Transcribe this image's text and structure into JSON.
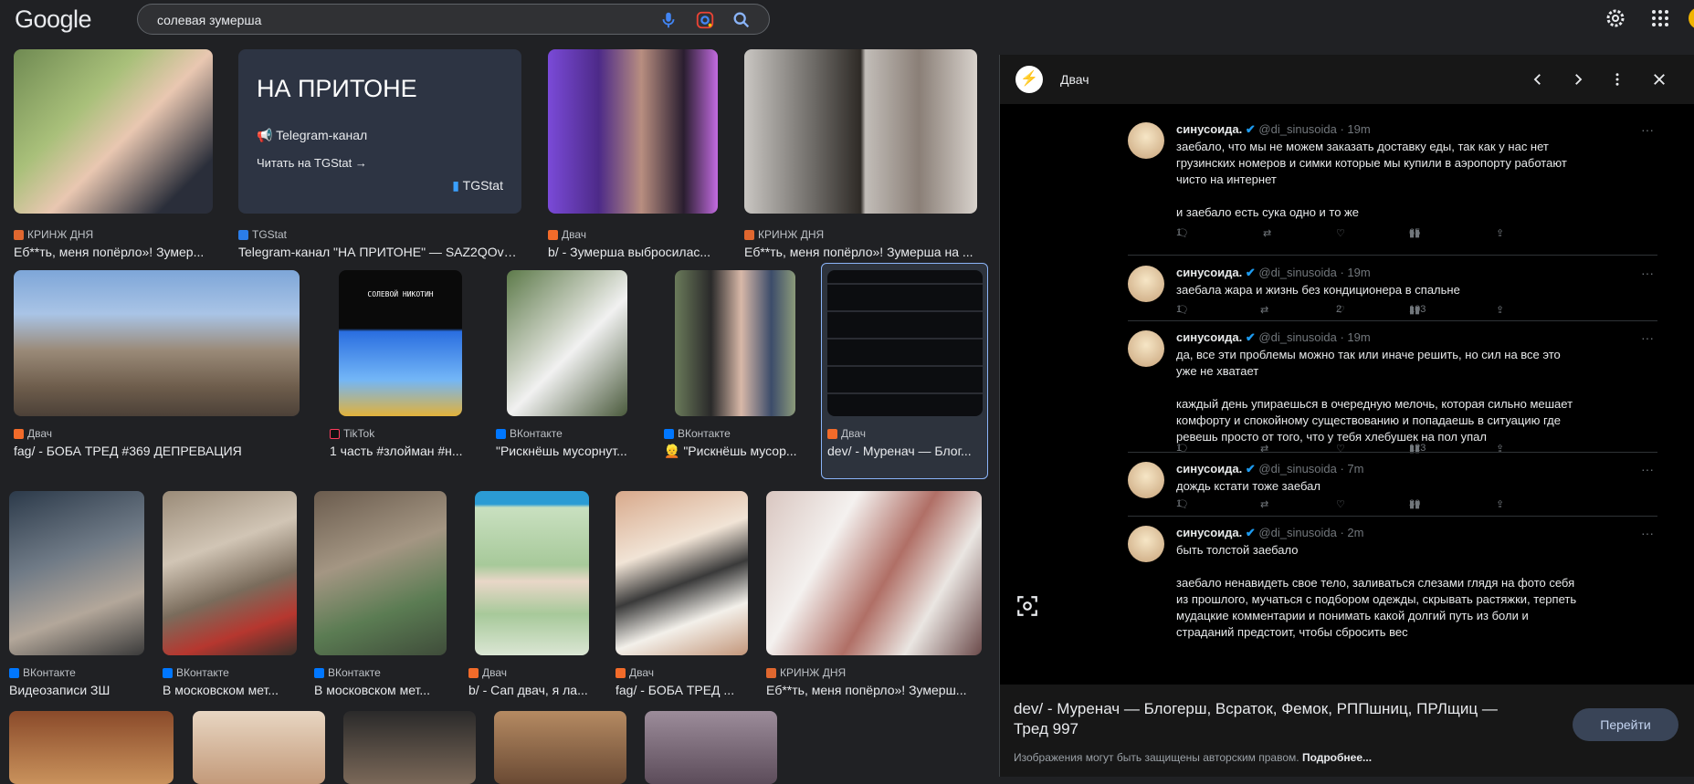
{
  "header": {
    "logo": "Google",
    "search_query": "солевая зумерша"
  },
  "results": [
    {
      "source": "КРИНЖ ДНЯ",
      "title": "Еб**ть, меня попёрло»! Зумер..."
    },
    {
      "source": "TGStat",
      "title": "Telegram-канал \"НА ПРИТОНЕ\" — SAZ2QOv1..."
    },
    {
      "source": "Двач",
      "title": "b/ - Зумерша выбросилас..."
    },
    {
      "source": "КРИНЖ ДНЯ",
      "title": "Еб**ть, меня попёрло»! Зумерша на ..."
    },
    {
      "source": "Двач",
      "title": "fag/ - БОБА ТРЕД #369 ДЕПРЕВАЦИЯ"
    },
    {
      "source": "TikTok",
      "title": "1 часть #злойман #н..."
    },
    {
      "source": "ВКонтакте",
      "title": "\"Рискнёшь мусорнут..."
    },
    {
      "source": "ВКонтакте",
      "title": "👱 \"Рискнёшь мусор..."
    },
    {
      "source": "Двач",
      "title": "dev/ - Муренач — Блог..."
    },
    {
      "source": "ВКонтакте",
      "title": "Видеозаписи ЗШ"
    },
    {
      "source": "ВКонтакте",
      "title": "В московском мет..."
    },
    {
      "source": "ВКонтакте",
      "title": "В московском мет..."
    },
    {
      "source": "Двач",
      "title": "b/ - Сап двач, я ла..."
    },
    {
      "source": "Двач",
      "title": "fag/ - БОБА ТРЕД ..."
    },
    {
      "source": "КРИНЖ ДНЯ",
      "title": "Еб**ть, меня попёрло»! Зумерш..."
    }
  ],
  "tgstat_card": {
    "heading": "НА ПРИТОНЕ",
    "channel": "Telegram-канал",
    "link": "Читать на TGStat",
    "brand": "TGStat"
  },
  "thumb_text": {
    "tiktok": "СОЛЕВОЙ НИКОТИН"
  },
  "panel": {
    "site_name": "Двач",
    "title": "dev/ - Муренач — Блогерш, Всраток, Фемок, РППшниц, ПРЛщиц — Тред 997",
    "copyright": "Изображения могут быть защищены авторским правом.",
    "more_link": "Подробнее...",
    "go_button": "Перейти"
  },
  "tweets": [
    {
      "name": "синусоида.",
      "handle": "@di_sinusoida · 19m",
      "body": "заебало, что мы не можем заказать доставку еды, так как у нас нет грузинских номеров и симки которые мы купили в аэропорту работают чисто на интернет\n\nи заебало есть сука одно и то же",
      "replies": "1",
      "reposts": "",
      "likes": "",
      "views": "65"
    },
    {
      "name": "синусоида.",
      "handle": "@di_sinusoida · 19m",
      "body": "заебала жара и жизнь без кондиционера в спальне",
      "replies": "1",
      "reposts": "",
      "likes": "2",
      "views": "103"
    },
    {
      "name": "синусоида.",
      "handle": "@di_sinusoida · 19m",
      "body": "да, все эти проблемы можно так или иначе решить, но сил на все это уже не хватает\n\nкаждый день упираешься в очередную мелочь, которая сильно мешает комфорту и спокойному существованию и попадаешь в ситуацию где ревешь просто от того, что у тебя хлебушек на пол упал",
      "replies": "1",
      "reposts": "",
      "likes": "",
      "views": "123"
    },
    {
      "name": "синусоида.",
      "handle": "@di_sinusoida · 7m",
      "body": "дождь кстати тоже заебал",
      "replies": "1",
      "reposts": "",
      "likes": "",
      "views": "30"
    },
    {
      "name": "синусоида.",
      "handle": "@di_sinusoida · 2m",
      "body": "быть толстой заебало\n\nзаебало ненавидеть свое тело, заливаться слезами глядя на фото себя из прошлого, мучаться с подбором одежды, скрывать растяжки, терпеть мудацкие комментарии и понимать какой долгий путь из боли и страданий предстоит, чтобы сбросить вес",
      "replies": "",
      "reposts": "",
      "likes": "",
      "views": ""
    }
  ],
  "colors": {
    "background": "#202124",
    "panel": "#171717",
    "accent": "#8ab4f8",
    "verified": "#1d9bf0"
  }
}
